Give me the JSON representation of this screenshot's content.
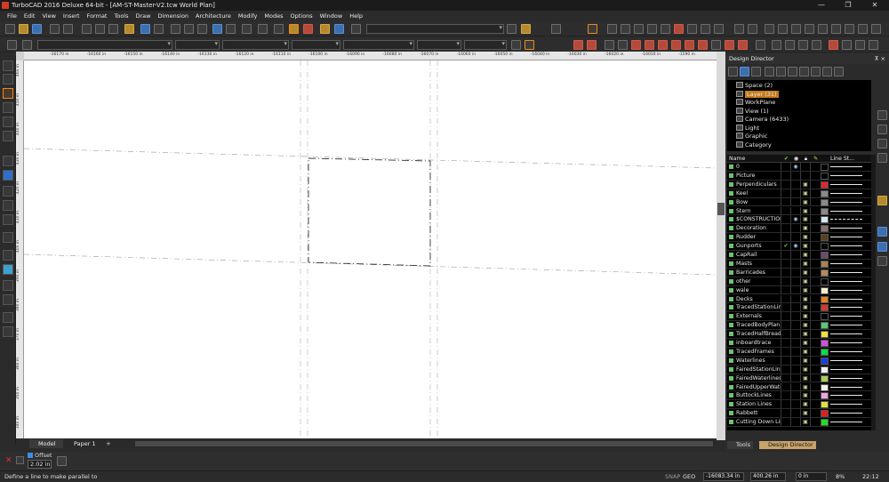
{
  "window": {
    "title": "TurboCAD 2016 Deluxe 64-bit - [AM-ST-Master-V2.tcw World Plan]"
  },
  "menu": [
    "File",
    "Edit",
    "View",
    "Insert",
    "Format",
    "Tools",
    "Draw",
    "Dimension",
    "Architecture",
    "Modify",
    "Modes",
    "Options",
    "Window",
    "Help"
  ],
  "ruler": {
    "h_labels": [
      "-16170 in",
      "-16160 in",
      "-16150 in",
      "-16140 in",
      "-16130 in",
      "-16120 in",
      "-16110 in",
      "-16100 in",
      "-16090 in",
      "-16080 in",
      "-16070 in",
      "-16060 in",
      "-16050 in",
      "-16040 in",
      "-16030 in",
      "-16020 in",
      "-16010 in",
      "-1590 in"
    ],
    "v_labels": [
      "460 in",
      "450 in",
      "440 in",
      "430 in",
      "420 in",
      "410 in",
      "400 in",
      "390 in",
      "380 in",
      "370 in",
      "360 in",
      "350 in",
      "340 in"
    ]
  },
  "tabs": {
    "model": "Model",
    "paper": "Paper 1"
  },
  "design_director": {
    "title": "Design Director",
    "pin": "⊼ ×",
    "tree": [
      {
        "label": "Space (2)",
        "level": 1
      },
      {
        "label": "Layer (31)",
        "level": 1,
        "selected": true
      },
      {
        "label": "WorkPlane",
        "level": 1
      },
      {
        "label": "View (1)",
        "level": 1
      },
      {
        "label": "Camera (6433)",
        "level": 1
      },
      {
        "label": "Light",
        "level": 1
      },
      {
        "label": "Graphic",
        "level": 1
      },
      {
        "label": "Category",
        "level": 1
      }
    ],
    "columns": {
      "name": "Name",
      "linestyle": "Line St..."
    },
    "layers": [
      {
        "name": "0",
        "vis": true,
        "lock": false,
        "color": "#000000"
      },
      {
        "name": "Picture",
        "vis": false,
        "lock": false,
        "color": "#000000"
      },
      {
        "name": "Perpendiculars",
        "vis": false,
        "lock": true,
        "color": "#e0262b"
      },
      {
        "name": "Keel",
        "vis": false,
        "lock": true,
        "color": "#8a8a8a"
      },
      {
        "name": "Bow",
        "vis": false,
        "lock": true,
        "color": "#8a8a8a"
      },
      {
        "name": "Stern",
        "vis": false,
        "lock": true,
        "color": "#8a8a8a"
      },
      {
        "name": "$CONSTRUCTION",
        "vis": true,
        "lock": true,
        "color": "#cfe7f0"
      },
      {
        "name": "Decoration",
        "vis": false,
        "lock": true,
        "color": "#8a6f6a"
      },
      {
        "name": "Rudder",
        "vis": false,
        "lock": true,
        "color": "#5a3f1e"
      },
      {
        "name": "Gunports",
        "vis": true,
        "lock": true,
        "color": "#000000",
        "checked": true
      },
      {
        "name": "CapRail",
        "vis": false,
        "lock": true,
        "color": "#6b4a6e"
      },
      {
        "name": "Masts",
        "vis": false,
        "lock": true,
        "color": "#a9824e"
      },
      {
        "name": "Barricades",
        "vis": false,
        "lock": true,
        "color": "#b58b5a"
      },
      {
        "name": "other",
        "vis": false,
        "lock": true,
        "color": "#000000"
      },
      {
        "name": "wale",
        "vis": false,
        "lock": true,
        "color": "#f3ecd0"
      },
      {
        "name": "Decks",
        "vis": false,
        "lock": true,
        "color": "#e8801e"
      },
      {
        "name": "TracedStationLines",
        "vis": false,
        "lock": true,
        "color": "#d8362a"
      },
      {
        "name": "Externals",
        "vis": false,
        "lock": true,
        "color": "#000000"
      },
      {
        "name": "TracedBodyPlan",
        "vis": false,
        "lock": true,
        "color": "#58c878"
      },
      {
        "name": "TracedHalfBreadth",
        "vis": false,
        "lock": true,
        "color": "#f0e040"
      },
      {
        "name": "inboardtrace",
        "vis": false,
        "lock": true,
        "color": "#d050e0"
      },
      {
        "name": "TracedFrames",
        "vis": false,
        "lock": true,
        "color": "#00e040"
      },
      {
        "name": "Waterlines",
        "vis": false,
        "lock": true,
        "color": "#1a3ce0"
      },
      {
        "name": "FairedStationLines",
        "vis": false,
        "lock": true,
        "color": "#f0f0f0"
      },
      {
        "name": "FairedWaterlines",
        "vis": false,
        "lock": true,
        "color": "#a8d050"
      },
      {
        "name": "FairedUpperWater",
        "vis": false,
        "lock": true,
        "color": "#f0f0f0"
      },
      {
        "name": "ButtockLines",
        "vis": false,
        "lock": true,
        "color": "#f0a0e8"
      },
      {
        "name": "Station Lines",
        "vis": false,
        "lock": true,
        "color": "#e0e040"
      },
      {
        "name": "Rabbett",
        "vis": false,
        "lock": true,
        "color": "#e02020"
      },
      {
        "name": "Cutting Down Line",
        "vis": false,
        "lock": true,
        "color": "#20e020"
      }
    ],
    "tabs": {
      "tools": "Tools",
      "director": "Design Director"
    }
  },
  "inspector": {
    "offset_label": "Offset",
    "offset_value": "2.02 in"
  },
  "status": {
    "prompt": "Define a line to make parallel to",
    "snap": "SNAP",
    "geo": "GEO",
    "x": "-16083.34 in",
    "y": "400.26 in",
    "z": "0 in",
    "zoom": "8%",
    "time": "22:12"
  },
  "colors": {
    "accent": "#f08a1e",
    "selected_layer": "#c47a1a"
  }
}
